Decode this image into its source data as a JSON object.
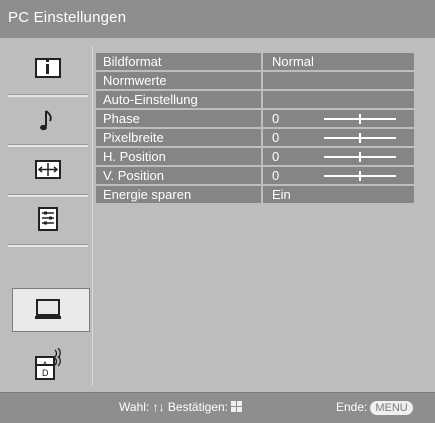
{
  "title": "PC Einstellungen",
  "sidebar": {
    "items": [
      {
        "icon": "picture-icon",
        "selected": false
      },
      {
        "icon": "sound-icon",
        "selected": false
      },
      {
        "icon": "screen-icon",
        "selected": false
      },
      {
        "icon": "setup-icon",
        "selected": false
      },
      {
        "icon": "pc-icon",
        "selected": true
      },
      {
        "icon": "analog-tv-icon",
        "selected": false
      },
      {
        "icon": "digital-tv-icon",
        "selected": false
      }
    ]
  },
  "menu": {
    "rows": [
      {
        "label": "Bildformat",
        "value": "Normal",
        "slider": null
      },
      {
        "label": "Normwerte",
        "value": "",
        "slider": null
      },
      {
        "label": "Auto-Einstellung",
        "value": "",
        "slider": null
      },
      {
        "label": "Phase",
        "value": "0",
        "slider": 0.5
      },
      {
        "label": "Pixelbreite",
        "value": "0",
        "slider": 0.5
      },
      {
        "label": "H. Position",
        "value": "0",
        "slider": 0.5
      },
      {
        "label": "V. Position",
        "value": "0",
        "slider": 0.5
      },
      {
        "label": "Energie sparen",
        "value": "Ein",
        "slider": null
      }
    ]
  },
  "footer": {
    "select_label": "Wahl:",
    "confirm_label": "Bestätigen:",
    "exit_label": "Ende:",
    "menu_key": "MENU"
  },
  "colors": {
    "background": "#bdbdbd",
    "title_bar": "#8e8e8e",
    "row": "#858585",
    "text": "#ffffff"
  }
}
